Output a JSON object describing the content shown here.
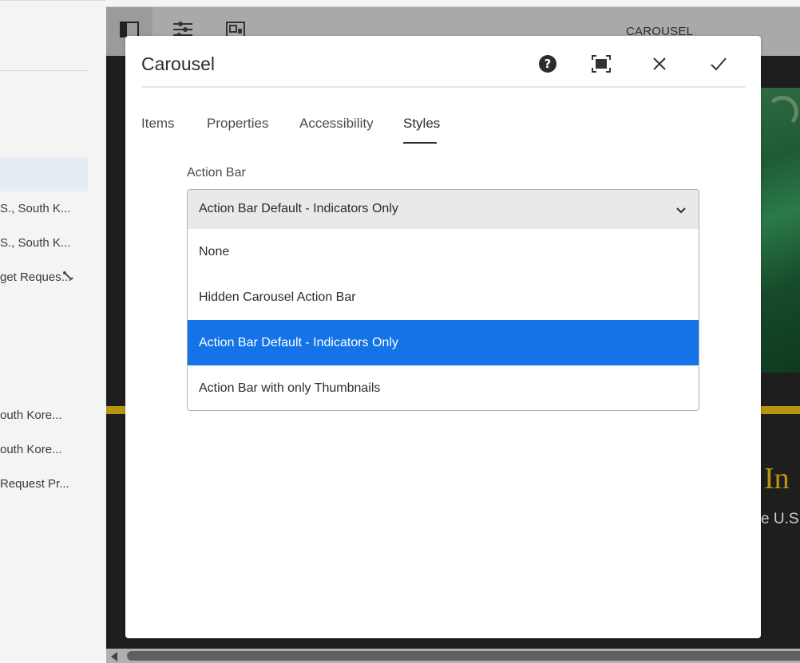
{
  "left_panel": {
    "items": [
      {
        "label": "S., South K..."
      },
      {
        "label": "S., South K..."
      },
      {
        "label": "get Reques..."
      },
      {
        "label": "outh Kore..."
      },
      {
        "label": "outh Kore..."
      },
      {
        "label": "Request Pr..."
      }
    ]
  },
  "editor": {
    "component_label": "CAROUSEL",
    "heading_fragment": "In",
    "body_fragment": "e U.S",
    "accent_gold": "#b9950f"
  },
  "dialog": {
    "title": "Carousel",
    "header_icons": [
      "help-icon",
      "fullscreen-icon",
      "close-icon",
      "checkmark-icon"
    ],
    "tabs": [
      {
        "label": "Items"
      },
      {
        "label": "Properties"
      },
      {
        "label": "Accessibility"
      },
      {
        "label": "Styles",
        "active": true
      }
    ],
    "field": {
      "label": "Action Bar",
      "value": "Action Bar Default - Indicators Only",
      "options": [
        {
          "label": "None"
        },
        {
          "label": "Hidden Carousel Action Bar"
        },
        {
          "label": "Action Bar Default - Indicators Only",
          "selected": true
        },
        {
          "label": "Action Bar with only Thumbnails"
        }
      ]
    },
    "selected_color": "#1473e6"
  }
}
